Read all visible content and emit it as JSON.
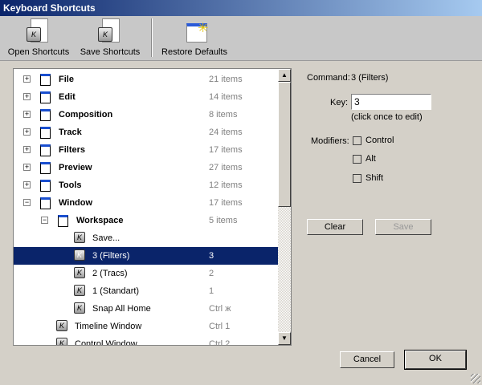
{
  "window": {
    "title": "Keyboard Shortcuts"
  },
  "toolbar": {
    "open": "Open Shortcuts",
    "save": "Save Shortcuts",
    "restore": "Restore Defaults"
  },
  "tree": [
    {
      "label": "File",
      "value": "21 items",
      "level": 0,
      "type": "group",
      "expanded": false
    },
    {
      "label": "Edit",
      "value": "14 items",
      "level": 0,
      "type": "group",
      "expanded": false
    },
    {
      "label": "Composition",
      "value": "8 items",
      "level": 0,
      "type": "group",
      "expanded": false
    },
    {
      "label": "Track",
      "value": "24 items",
      "level": 0,
      "type": "group",
      "expanded": false
    },
    {
      "label": "Filters",
      "value": "17 items",
      "level": 0,
      "type": "group",
      "expanded": false
    },
    {
      "label": "Preview",
      "value": "27 items",
      "level": 0,
      "type": "group",
      "expanded": false
    },
    {
      "label": "Tools",
      "value": "12 items",
      "level": 0,
      "type": "group",
      "expanded": false
    },
    {
      "label": "Window",
      "value": "17 items",
      "level": 0,
      "type": "group",
      "expanded": true
    },
    {
      "label": "Workspace",
      "value": "5 items",
      "level": 1,
      "type": "group",
      "expanded": true
    },
    {
      "label": "Save...",
      "value": "",
      "level": 2,
      "type": "command"
    },
    {
      "label": "3 (Filters)",
      "value": "3",
      "level": 2,
      "type": "command",
      "selected": true
    },
    {
      "label": "2 (Tracs)",
      "value": "2",
      "level": 2,
      "type": "command"
    },
    {
      "label": "1 (Standart)",
      "value": "1",
      "level": 2,
      "type": "command"
    },
    {
      "label": "Snap All Home",
      "value": "Ctrl ж",
      "level": 2,
      "type": "command"
    },
    {
      "label": "Timeline Window",
      "value": "Ctrl 1",
      "level": 1,
      "type": "command"
    },
    {
      "label": "Control Window",
      "value": "Ctrl 2",
      "level": 1,
      "type": "command"
    }
  ],
  "details": {
    "command_label": "Command:",
    "command_value": "3 (Filters)",
    "key_label": "Key:",
    "key_value": "3",
    "hint": "(click once to edit)",
    "modifiers_label": "Modifiers:",
    "modifiers": [
      {
        "label": "Control",
        "checked": false
      },
      {
        "label": "Alt",
        "checked": false
      },
      {
        "label": "Shift",
        "checked": false
      }
    ],
    "clear": "Clear",
    "save": "Save"
  },
  "footer": {
    "cancel": "Cancel",
    "ok": "OK"
  }
}
